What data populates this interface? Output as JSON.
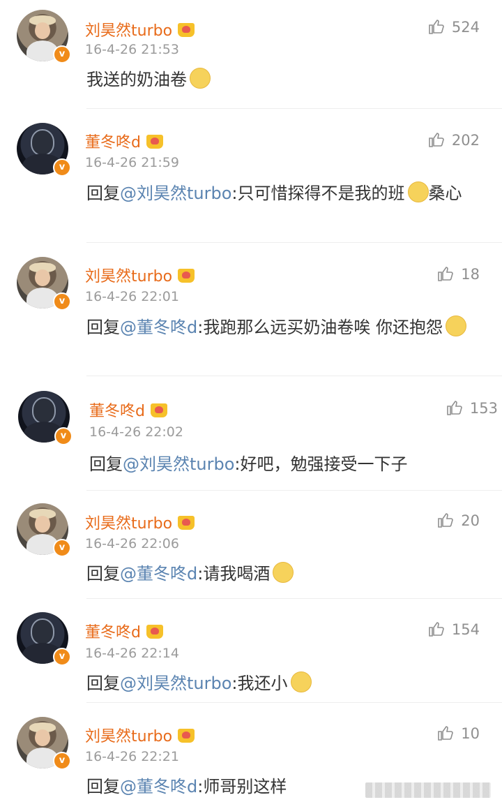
{
  "comments": [
    {
      "name": "刘昊然turbo",
      "time": "16-4-26 21:53",
      "likes": "524",
      "reply_prefix": "",
      "mention": "",
      "text": "我送的奶油卷",
      "emoji": "smirk-emoji",
      "avatar": "avatar-liu"
    },
    {
      "name": "董冬咚d",
      "time": "16-4-26 21:59",
      "likes": "202",
      "reply_prefix": "回复",
      "mention": "@刘昊然turbo",
      "text": ":只可惜探得不是我的班",
      "text2": "桑心",
      "emoji": "sad-emoji",
      "avatar": "avatar-dong"
    },
    {
      "name": "刘昊然turbo",
      "time": "16-4-26 22:01",
      "likes": "18",
      "reply_prefix": "回复",
      "mention": "@董冬咚d",
      "text": ":我跑那么远买奶油卷唉 你还抱怨",
      "emoji": "smirk-emoji",
      "avatar": "avatar-liu"
    },
    {
      "name": "董冬咚d",
      "time": "16-4-26 22:02",
      "likes": "153",
      "reply_prefix": "回复",
      "mention": "@刘昊然turbo",
      "text": ":好吧，勉强接受一下子",
      "emoji": "",
      "avatar": "avatar-dong"
    },
    {
      "name": "刘昊然turbo",
      "time": "16-4-26 22:06",
      "likes": "20",
      "reply_prefix": "回复",
      "mention": "@董冬咚d",
      "text": ":请我喝酒",
      "emoji": "doge-emoji",
      "avatar": "avatar-liu"
    },
    {
      "name": "董冬咚d",
      "time": "16-4-26 22:14",
      "likes": "154",
      "reply_prefix": "回复",
      "mention": "@刘昊然turbo",
      "text": ":我还小",
      "emoji": "shy-emoji",
      "avatar": "avatar-dong"
    },
    {
      "name": "刘昊然turbo",
      "time": "16-4-26 22:21",
      "likes": "10",
      "reply_prefix": "回复",
      "mention": "@董冬咚d",
      "text": ":师哥别这样",
      "emoji": "",
      "avatar": "avatar-liu"
    }
  ],
  "colors": {
    "name": "#e86b1a",
    "mention": "#5b84b1",
    "time": "#9b9b9b",
    "text": "#333333",
    "verified": "#f08b19"
  }
}
